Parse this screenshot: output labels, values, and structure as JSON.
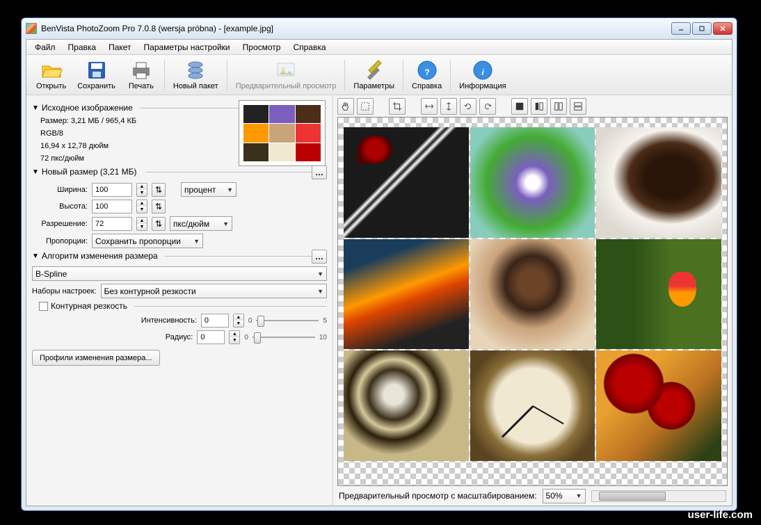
{
  "titlebar": {
    "title": "BenVista PhotoZoom Pro 7.0.8 (wersja próbna) - [example.jpg]"
  },
  "menus": [
    "Файл",
    "Правка",
    "Пакет",
    "Параметры настройки",
    "Просмотр",
    "Справка"
  ],
  "toolbar": {
    "open": "Открыть",
    "save": "Сохранить",
    "print": "Печать",
    "newbatch": "Новый пакет",
    "preview": "Предварительный просмотр",
    "params": "Параметры",
    "help": "Справка",
    "info": "Информация"
  },
  "source": {
    "header": "Исходное изображение",
    "size": "Размер: 3,21 МБ / 965,4 КБ",
    "mode": "RGB/8",
    "dims": "16,94 x 12,78 дюйм",
    "dpi": "72 пкс/дюйм"
  },
  "newsize": {
    "header": "Новый размер (3,21 МБ)",
    "width_label": "Ширина:",
    "width": "100",
    "height_label": "Высота:",
    "height": "100",
    "unit": "процент",
    "res_label": "Разрешение:",
    "res": "72",
    "res_unit": "пкс/дюйм",
    "prop_label": "Пропорции:",
    "prop": "Сохранить пропорции"
  },
  "resize": {
    "header": "Алгоритм изменения размера",
    "method": "B-Spline",
    "presets_label": "Наборы настроек:",
    "presets": "Без контурной резкости",
    "unsharp": "Контурная резкость",
    "intensity_label": "Интенсивность:",
    "intensity": "0",
    "intensity_max": "5",
    "radius_label": "Радиус:",
    "radius": "0",
    "radius_max": "10",
    "profiles": "Профили изменения размера..."
  },
  "preview": {
    "bottom_label": "Предварительный просмотр с масштабированием:",
    "zoom": "50%"
  },
  "watermark": "user-life.com"
}
